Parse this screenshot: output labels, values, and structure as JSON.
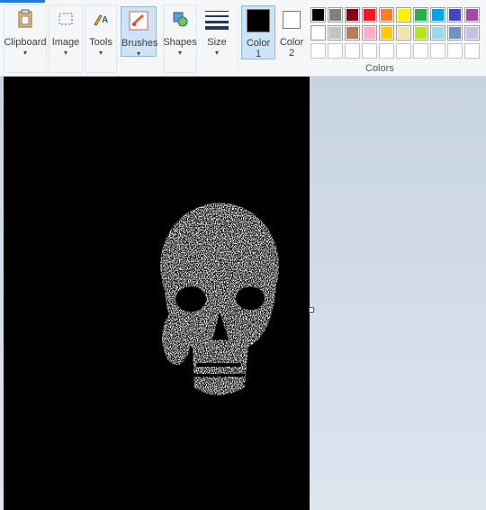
{
  "ribbon": {
    "clipboard": {
      "label": "Clipboard",
      "icon": "clipboard-icon"
    },
    "image": {
      "label": "Image",
      "icon": "select-rectangle-icon"
    },
    "tools": {
      "label": "Tools",
      "icon": "tools-icon"
    },
    "brushes": {
      "label": "Brushes",
      "icon": "brush-icon",
      "selected": true
    },
    "shapes": {
      "label": "Shapes",
      "icon": "shapes-icon"
    },
    "size": {
      "label": "Size",
      "icon": "line-size-icon"
    },
    "color1": {
      "label_line1": "Color",
      "label_line2": "1",
      "value": "#000000",
      "selected": true
    },
    "color2": {
      "label_line1": "Color",
      "label_line2": "2",
      "value": "#ffffff"
    },
    "colors_label": "Colors",
    "palette_row1": [
      "#000000",
      "#7f7f7f",
      "#880015",
      "#ed1c24",
      "#ff7f27",
      "#fff200",
      "#22b14c",
      "#00a2e8",
      "#3f48cc",
      "#a349a4"
    ],
    "palette_row2": [
      "#ffffff",
      "#c3c3c3",
      "#b97a57",
      "#ffaec9",
      "#ffc90e",
      "#efe4b0",
      "#b5e61d",
      "#99d9ea",
      "#7092be",
      "#c8bfe7"
    ],
    "palette_row3": [
      "",
      "",
      "",
      "",
      "",
      "",
      "",
      "",
      "",
      ""
    ]
  },
  "canvas": {
    "background": "#000000",
    "content": "skull-image"
  }
}
